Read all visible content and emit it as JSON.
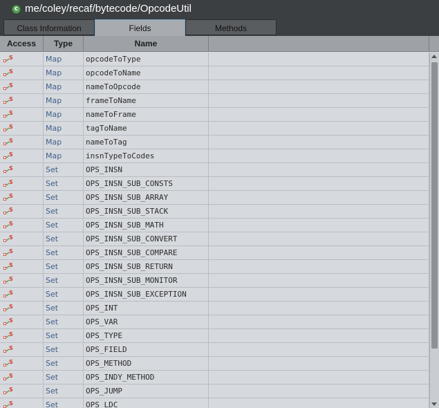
{
  "window": {
    "title": "me/coley/recaf/bytecode/OpcodeUtil",
    "class_icon_letter": "c"
  },
  "tabs": [
    {
      "label": "Class Information",
      "active": false
    },
    {
      "label": "Fields",
      "active": true
    },
    {
      "label": "Methods",
      "active": false
    }
  ],
  "table": {
    "columns": [
      "Access",
      "Type",
      "Name"
    ],
    "access_icon": "private-static-field-icon",
    "rows": [
      {
        "type": "Map",
        "name": "opcodeToType"
      },
      {
        "type": "Map",
        "name": "opcodeToName"
      },
      {
        "type": "Map",
        "name": "nameToOpcode"
      },
      {
        "type": "Map",
        "name": "frameToName"
      },
      {
        "type": "Map",
        "name": "nameToFrame"
      },
      {
        "type": "Map",
        "name": "tagToName"
      },
      {
        "type": "Map",
        "name": "nameToTag"
      },
      {
        "type": "Map",
        "name": "insnTypeToCodes"
      },
      {
        "type": "Set",
        "name": "OPS_INSN"
      },
      {
        "type": "Set",
        "name": "OPS_INSN_SUB_CONSTS"
      },
      {
        "type": "Set",
        "name": "OPS_INSN_SUB_ARRAY"
      },
      {
        "type": "Set",
        "name": "OPS_INSN_SUB_STACK"
      },
      {
        "type": "Set",
        "name": "OPS_INSN_SUB_MATH"
      },
      {
        "type": "Set",
        "name": "OPS_INSN_SUB_CONVERT"
      },
      {
        "type": "Set",
        "name": "OPS_INSN_SUB_COMPARE"
      },
      {
        "type": "Set",
        "name": "OPS_INSN_SUB_RETURN"
      },
      {
        "type": "Set",
        "name": "OPS_INSN_SUB_MONITOR"
      },
      {
        "type": "Set",
        "name": "OPS_INSN_SUB_EXCEPTION"
      },
      {
        "type": "Set",
        "name": "OPS_INT"
      },
      {
        "type": "Set",
        "name": "OPS_VAR"
      },
      {
        "type": "Set",
        "name": "OPS_TYPE"
      },
      {
        "type": "Set",
        "name": "OPS_FIELD"
      },
      {
        "type": "Set",
        "name": "OPS_METHOD"
      },
      {
        "type": "Set",
        "name": "OPS_INDY_METHOD"
      },
      {
        "type": "Set",
        "name": "OPS_JUMP"
      },
      {
        "type": "Set",
        "name": "OPS_LDC"
      }
    ]
  },
  "colors": {
    "icon_red": "#d23b2e",
    "icon_green": "#4e9a3e",
    "type_text": "#3f5f8a"
  }
}
